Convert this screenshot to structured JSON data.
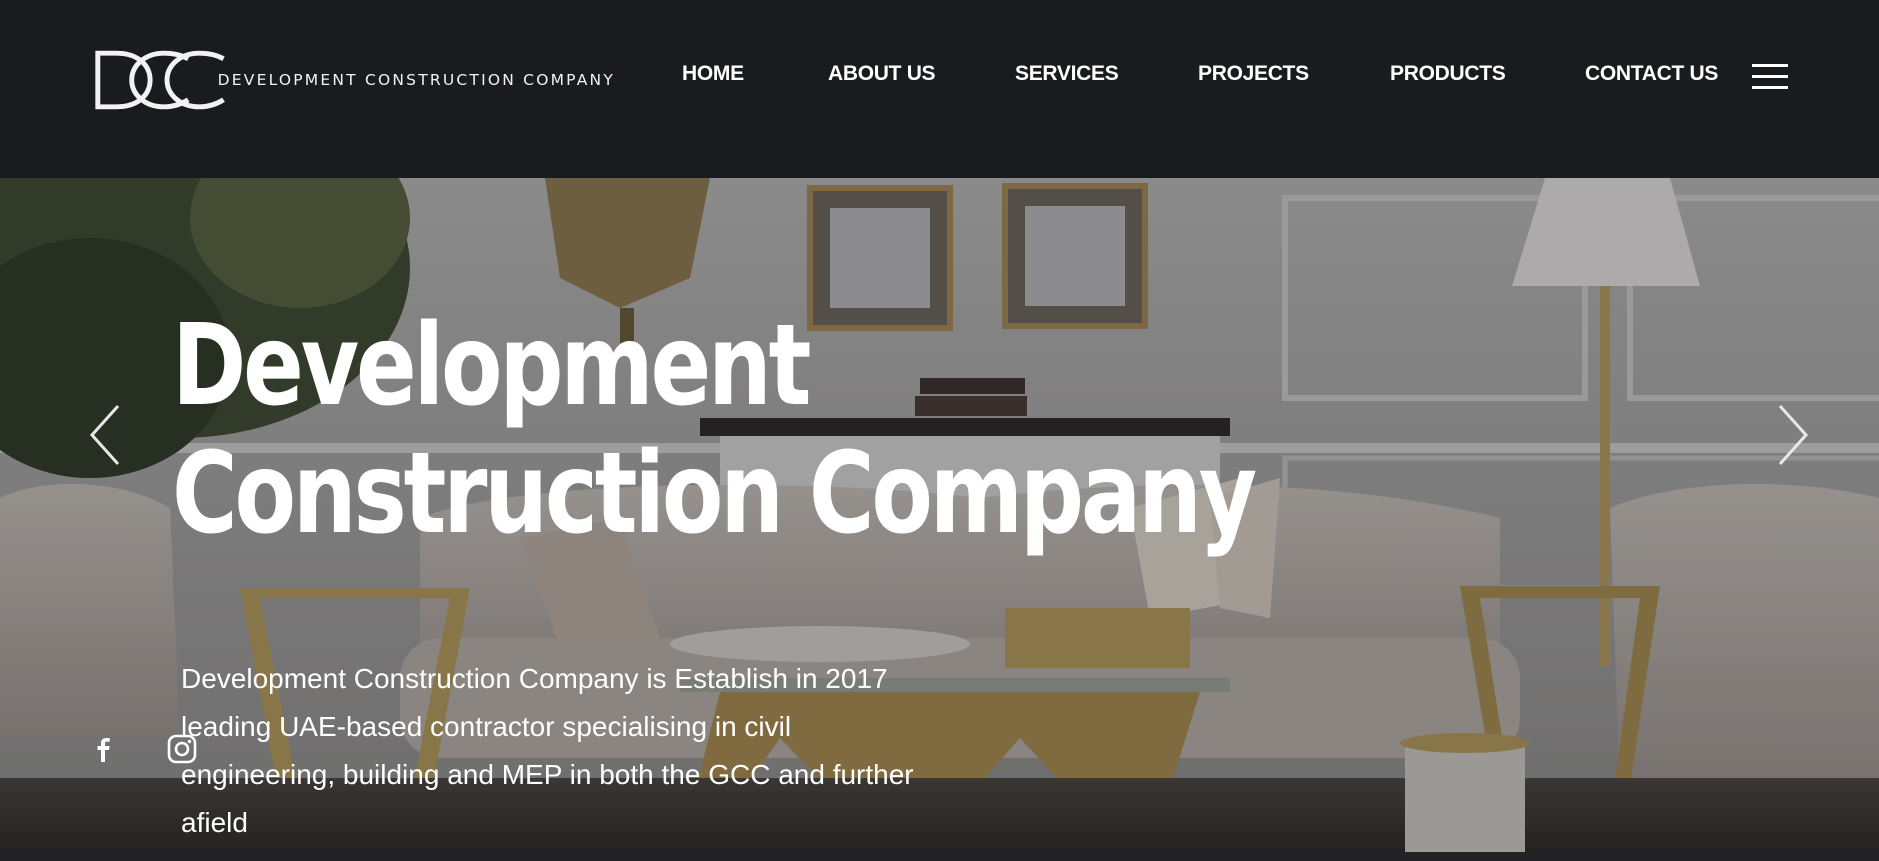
{
  "brand": {
    "logo_letters": "DCC",
    "name": "DEVELOPMENT CONSTRUCTION COMPANY"
  },
  "nav": {
    "items": [
      "HOME",
      "ABOUT US",
      "SERVICES",
      "PROJECTS",
      "PRODUCTS",
      "CONTACT US"
    ],
    "menu_icon": "hamburger-menu-icon"
  },
  "hero": {
    "title_line1": "Development",
    "title_line2": "Construction Company",
    "description": "Development Construction Company is Establish in 2017 leading UAE-based contractor specialising in civil engineering, building and MEP in both the GCC and further afield",
    "prev_icon": "chevron-left-icon",
    "next_icon": "chevron-right-icon"
  },
  "social": {
    "icons": [
      "facebook-icon",
      "instagram-icon"
    ]
  },
  "colors": {
    "header_bg": "#1a1b1e",
    "text": "#ffffff",
    "accent_gold": "#c9a552"
  }
}
